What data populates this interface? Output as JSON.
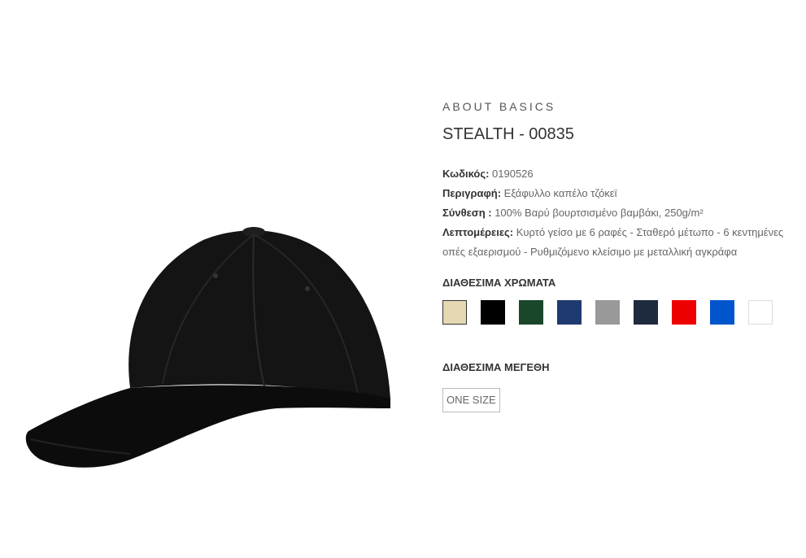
{
  "product": {
    "brand": "ABOUT BASICS",
    "title": "STEALTH - 00835",
    "image_alt": "black 6-panel baseball cap"
  },
  "specs": [
    {
      "key": "Κωδικός:",
      "value": " 0190526"
    },
    {
      "key": "Περιγραφή:",
      "value": " Εξάφυλλο καπέλο τζόκεϊ"
    },
    {
      "key": "Σύνθεση :",
      "value": " 100% Βαρύ βουρτσισμένο βαμβάκι, 250g/m²"
    },
    {
      "key": "Λεπτομέρειες:",
      "value": " Κυρτό γείσο με 6 ραφές - Σταθερό μέτωπο - 6 κεντημένες οπές εξαερισμού - Ρυθμιζόμενο κλείσιμο με μεταλλική αγκράφα"
    }
  ],
  "colors": {
    "heading": "ΔΙΑΘΕΣΙΜΑ ΧΡΩΜΑΤΑ",
    "swatches": [
      {
        "name": "beige",
        "hex": "#e5d8b4",
        "selected": true
      },
      {
        "name": "black",
        "hex": "#000000"
      },
      {
        "name": "dark-green",
        "hex": "#1a472a"
      },
      {
        "name": "navy",
        "hex": "#1f3a6e"
      },
      {
        "name": "grey",
        "hex": "#999999"
      },
      {
        "name": "dark-navy",
        "hex": "#1e2a3e"
      },
      {
        "name": "red",
        "hex": "#ee0000"
      },
      {
        "name": "royal-blue",
        "hex": "#0055cc"
      },
      {
        "name": "white",
        "hex": "#ffffff"
      }
    ]
  },
  "sizes": {
    "heading": "ΔΙΑΘΕΣΙΜΑ ΜΕΓΕΘΗ",
    "options": [
      "ONE SIZE"
    ]
  }
}
